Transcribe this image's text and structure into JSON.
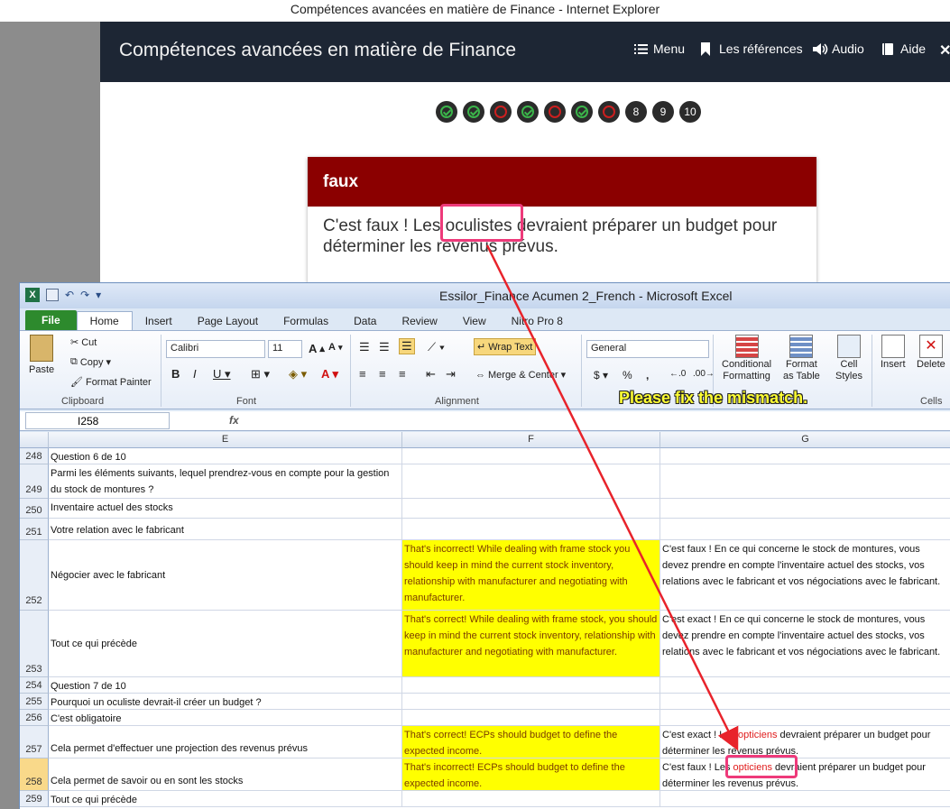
{
  "ie": {
    "window_title": "Compétences avancées en matière de Finance - Internet Explorer",
    "course_title": "Compétences avancées en matière de Finance",
    "menu": [
      {
        "icon": "list-icon",
        "label": "Menu"
      },
      {
        "icon": "bookmark-icon",
        "label": "Les références"
      },
      {
        "icon": "speaker-icon",
        "label": "Audio"
      },
      {
        "icon": "book-icon",
        "label": "Aide"
      }
    ],
    "question_progress": [
      "correct",
      "correct",
      "incorrect",
      "correct",
      "incorrect",
      "correct",
      "incorrect",
      "8",
      "9",
      "10"
    ],
    "feedback": {
      "heading": "faux",
      "before": "C'est faux ! Les ",
      "highlight": "oculistes",
      "after": " devraient préparer un budget pour déterminer les revenus prévus."
    }
  },
  "excel": {
    "window_title": "Essilor_Finance Acumen 2_French  -  Microsoft Excel",
    "tabs": [
      "File",
      "Home",
      "Insert",
      "Page Layout",
      "Formulas",
      "Data",
      "Review",
      "View",
      "Nitro Pro 8"
    ],
    "ribbon": {
      "paste": "Paste",
      "cut": "Cut",
      "copy": "Copy",
      "format_painter": "Format Painter",
      "clipboard": "Clipboard",
      "font_name": "Calibri",
      "font_size": "11",
      "font": "Font",
      "wrap_text": "Wrap Text",
      "merge_center": "Merge & Center",
      "alignment": "Alignment",
      "number_format": "General",
      "conditional_formatting_1": "Conditional",
      "conditional_formatting_2": "Formatting",
      "format_as_table_1": "Format",
      "format_as_table_2": "as Table",
      "cell_styles_1": "Cell",
      "cell_styles_2": "Styles",
      "insert": "Insert",
      "delete": "Delete",
      "cells": "Cells"
    },
    "annotation_note": "Please fix the mismatch.",
    "name_box": "I258",
    "fx": "fx",
    "columns": [
      "E",
      "F",
      "G"
    ],
    "rows": [
      {
        "n": "248",
        "e": "Question 6 de 10",
        "f": "",
        "g": ""
      },
      {
        "n": "249",
        "e": "Parmi les éléments suivants, lequel prendrez-vous en compte pour la gestion du stock de montures ?",
        "f": "",
        "g": ""
      },
      {
        "n": "250",
        "e": "Inventaire actuel des stocks",
        "f": "",
        "g": ""
      },
      {
        "n": "251",
        "e": "Votre relation avec le fabricant",
        "f": "",
        "g": ""
      },
      {
        "n": "252",
        "e": "Négocier avec le fabricant",
        "f": "That's incorrect! While dealing with frame stock you should keep in mind the current stock inventory, relationship with manufacturer and negotiating with manufacturer.",
        "g": "C'est faux ! En ce qui concerne le stock de montures, vous devez prendre en compte l'inventaire actuel des stocks, vos relations avec le fabricant et vos négociations avec le fabricant."
      },
      {
        "n": "253",
        "e": "Tout ce qui précède",
        "f": "That's correct! While dealing with frame stock, you should keep in mind the current stock inventory, relationship with manufacturer and negotiating with manufacturer.",
        "g": "C'est exact ! En ce qui concerne le stock de montures, vous devez prendre en compte l'inventaire actuel des stocks, vos relations avec le fabricant et vos négociations avec le fabricant."
      },
      {
        "n": "254",
        "e": "Question 7 de 10",
        "f": "",
        "g": ""
      },
      {
        "n": "255",
        "e": "Pourquoi un oculiste devrait-il créer un budget ?",
        "f": "",
        "g": ""
      },
      {
        "n": "256",
        "e": "C'est obligatoire",
        "f": "",
        "g": ""
      },
      {
        "n": "257",
        "e": "Cela permet d'effectuer une projection des revenus prévus",
        "f": "That's correct! ECPs should budget to define the expected income.",
        "g_before": "C'est exact ! Les ",
        "g_red": "opticiens",
        "g_after": " devraient préparer un budget pour déterminer les revenus prévus."
      },
      {
        "n": "258",
        "e": "Cela permet de savoir ou en sont les stocks",
        "f": "That's incorrect! ECPs should budget to define the expected income.",
        "g_before": "C'est faux ! Les ",
        "g_red": "opticiens",
        "g_after": " devraient préparer un budget pour déterminer les revenus prévus."
      },
      {
        "n": "259",
        "e": "Tout ce qui précède",
        "f": "",
        "g": ""
      }
    ]
  },
  "colors": {
    "ie_header": "#1d2634",
    "feedback_red": "#8b0000",
    "highlight_pink": "#ee3a7a",
    "arrow_red": "#e8232b",
    "note_yellow": "#ffff33"
  }
}
